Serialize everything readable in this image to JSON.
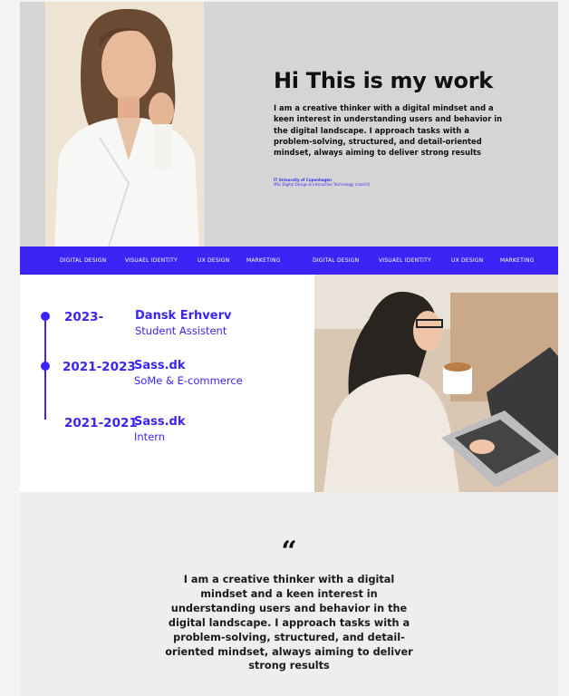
{
  "hero": {
    "title": "Hi This is my work",
    "body": "I am a creative thinker with a digital mindset and a keen interest in understanding users and behavior in the digital landscape. I approach tasks with a problem-solving, structured, and detail-oriented mindset, always aiming to deliver strong results",
    "school": "IT University of Copenhagen",
    "degree": "MSc Digital Design & Interactive Technology (cand.it)"
  },
  "nav": {
    "items": [
      "DIGITAL DESIGN",
      "VISUAEL IDENTITY",
      "UX DESIGN",
      "MARKETING",
      "DIGITAL DESIGN",
      "VISUAEL IDENTITY",
      "UX DESIGN",
      "MARKETING"
    ]
  },
  "timeline": {
    "entries": [
      {
        "year": "2023-",
        "company": "Dansk Erhverv",
        "role": "Student Assistent"
      },
      {
        "year": "2021-2023",
        "company": "Sass.dk",
        "role": "SoMe & E-commerce"
      },
      {
        "year": "2021-2021",
        "company": "Sass.dk",
        "role": "Intern"
      }
    ]
  },
  "quote": {
    "mark": "“",
    "text": "I am a creative thinker with a digital mindset and a keen interest in understanding users and behavior in the digital landscape. I approach tasks with a problem-solving, structured, and detail-oriented mindset, always aiming to deliver strong results"
  },
  "colors": {
    "accent": "#3b24f5",
    "hero_bg": "#d5d5d5",
    "quote_bg": "#efeeec"
  }
}
